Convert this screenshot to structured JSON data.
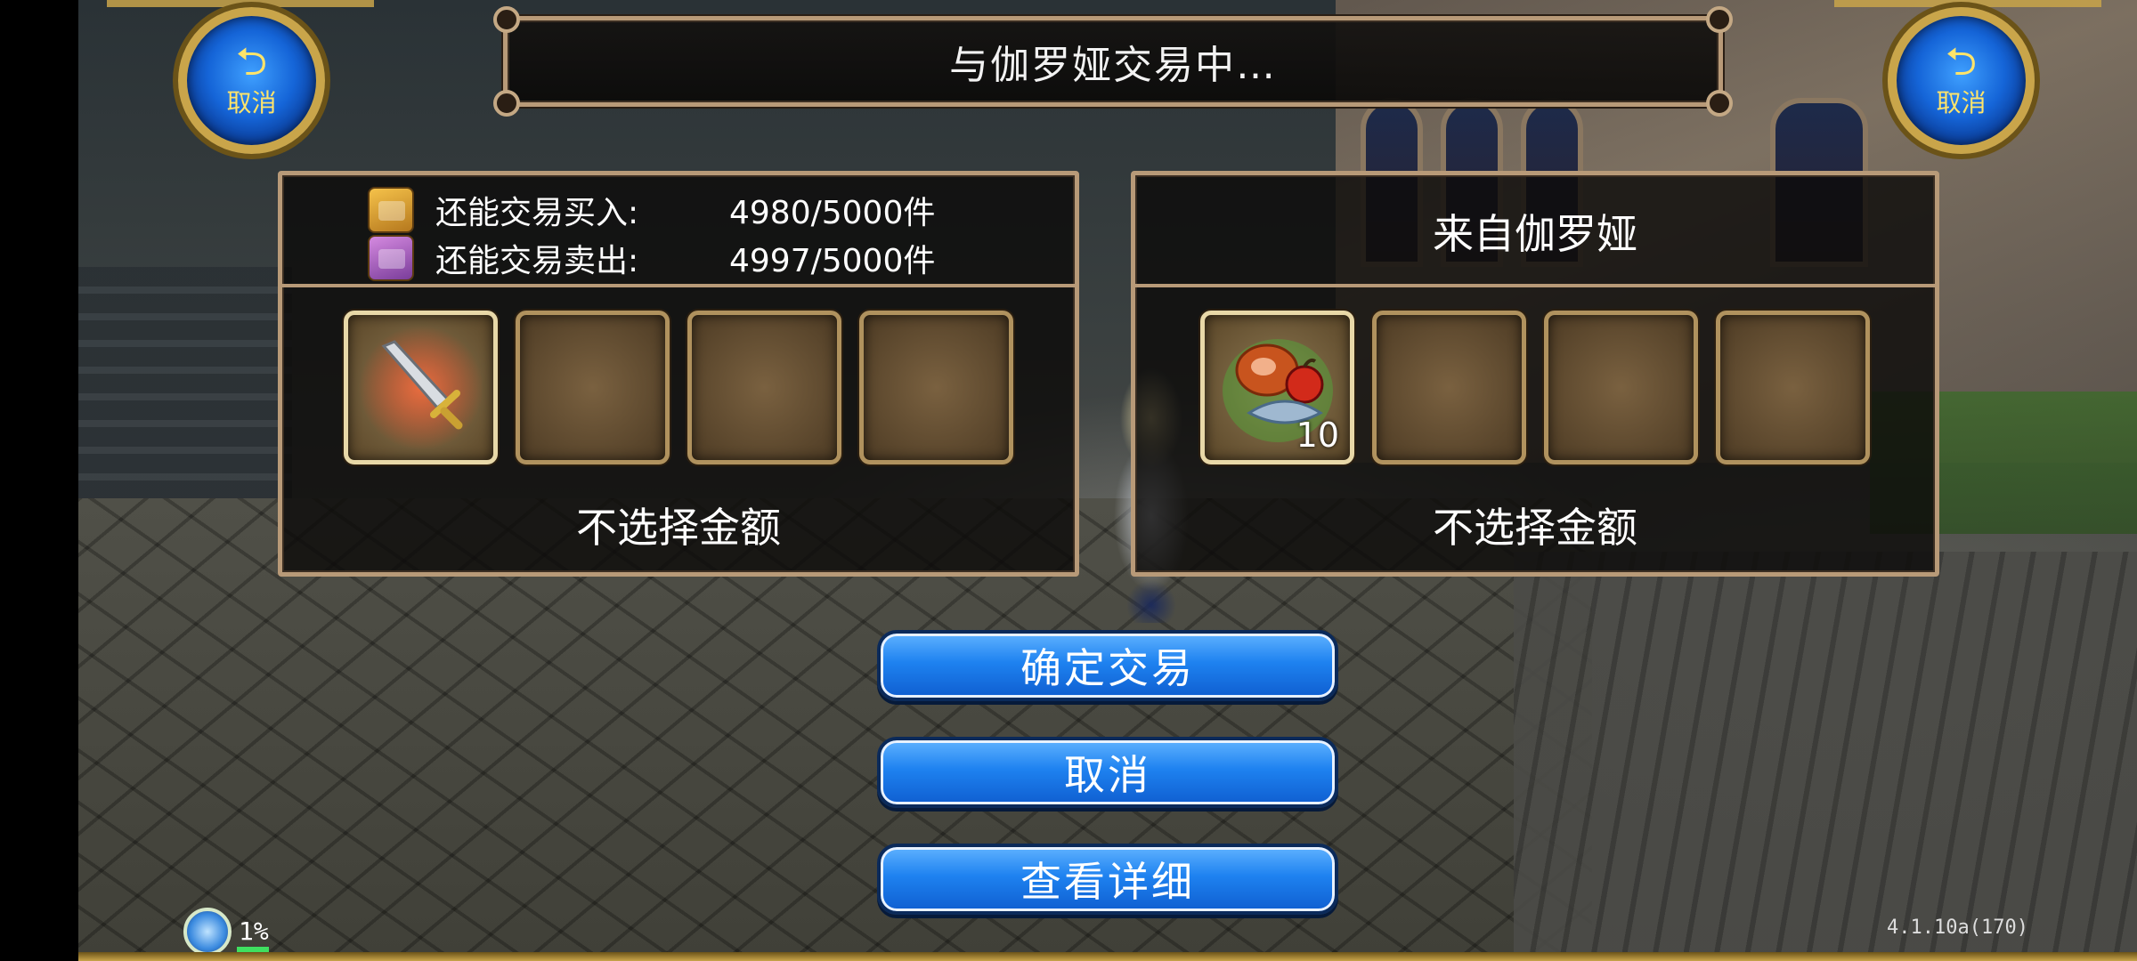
{
  "title": "与伽罗娅交易中…",
  "cancel_round": {
    "label": "取消"
  },
  "left_panel": {
    "buy_label": "还能交易买入:",
    "buy_value": "4980/5000件",
    "sell_label": "还能交易卖出:",
    "sell_value": "4997/5000件",
    "slots": [
      {
        "item": "sword-icon",
        "quantity": ""
      },
      {
        "item": "",
        "quantity": ""
      },
      {
        "item": "",
        "quantity": ""
      },
      {
        "item": "",
        "quantity": ""
      }
    ],
    "money_label": "不选择金额"
  },
  "right_panel": {
    "from_label": "来自伽罗娅",
    "slots": [
      {
        "item": "food-icon",
        "quantity": "10"
      },
      {
        "item": "",
        "quantity": ""
      },
      {
        "item": "",
        "quantity": ""
      },
      {
        "item": "",
        "quantity": ""
      }
    ],
    "money_label": "不选择金额"
  },
  "buttons": {
    "confirm": "确定交易",
    "cancel": "取消",
    "details": "查看详细"
  },
  "hud": {
    "exp_percent": "1%",
    "version": "4.1.10a(170)"
  },
  "colors": {
    "button_blue": "#1e82f0",
    "frame_gold": "#b89a78",
    "round_button_text": "#ffe46a"
  }
}
